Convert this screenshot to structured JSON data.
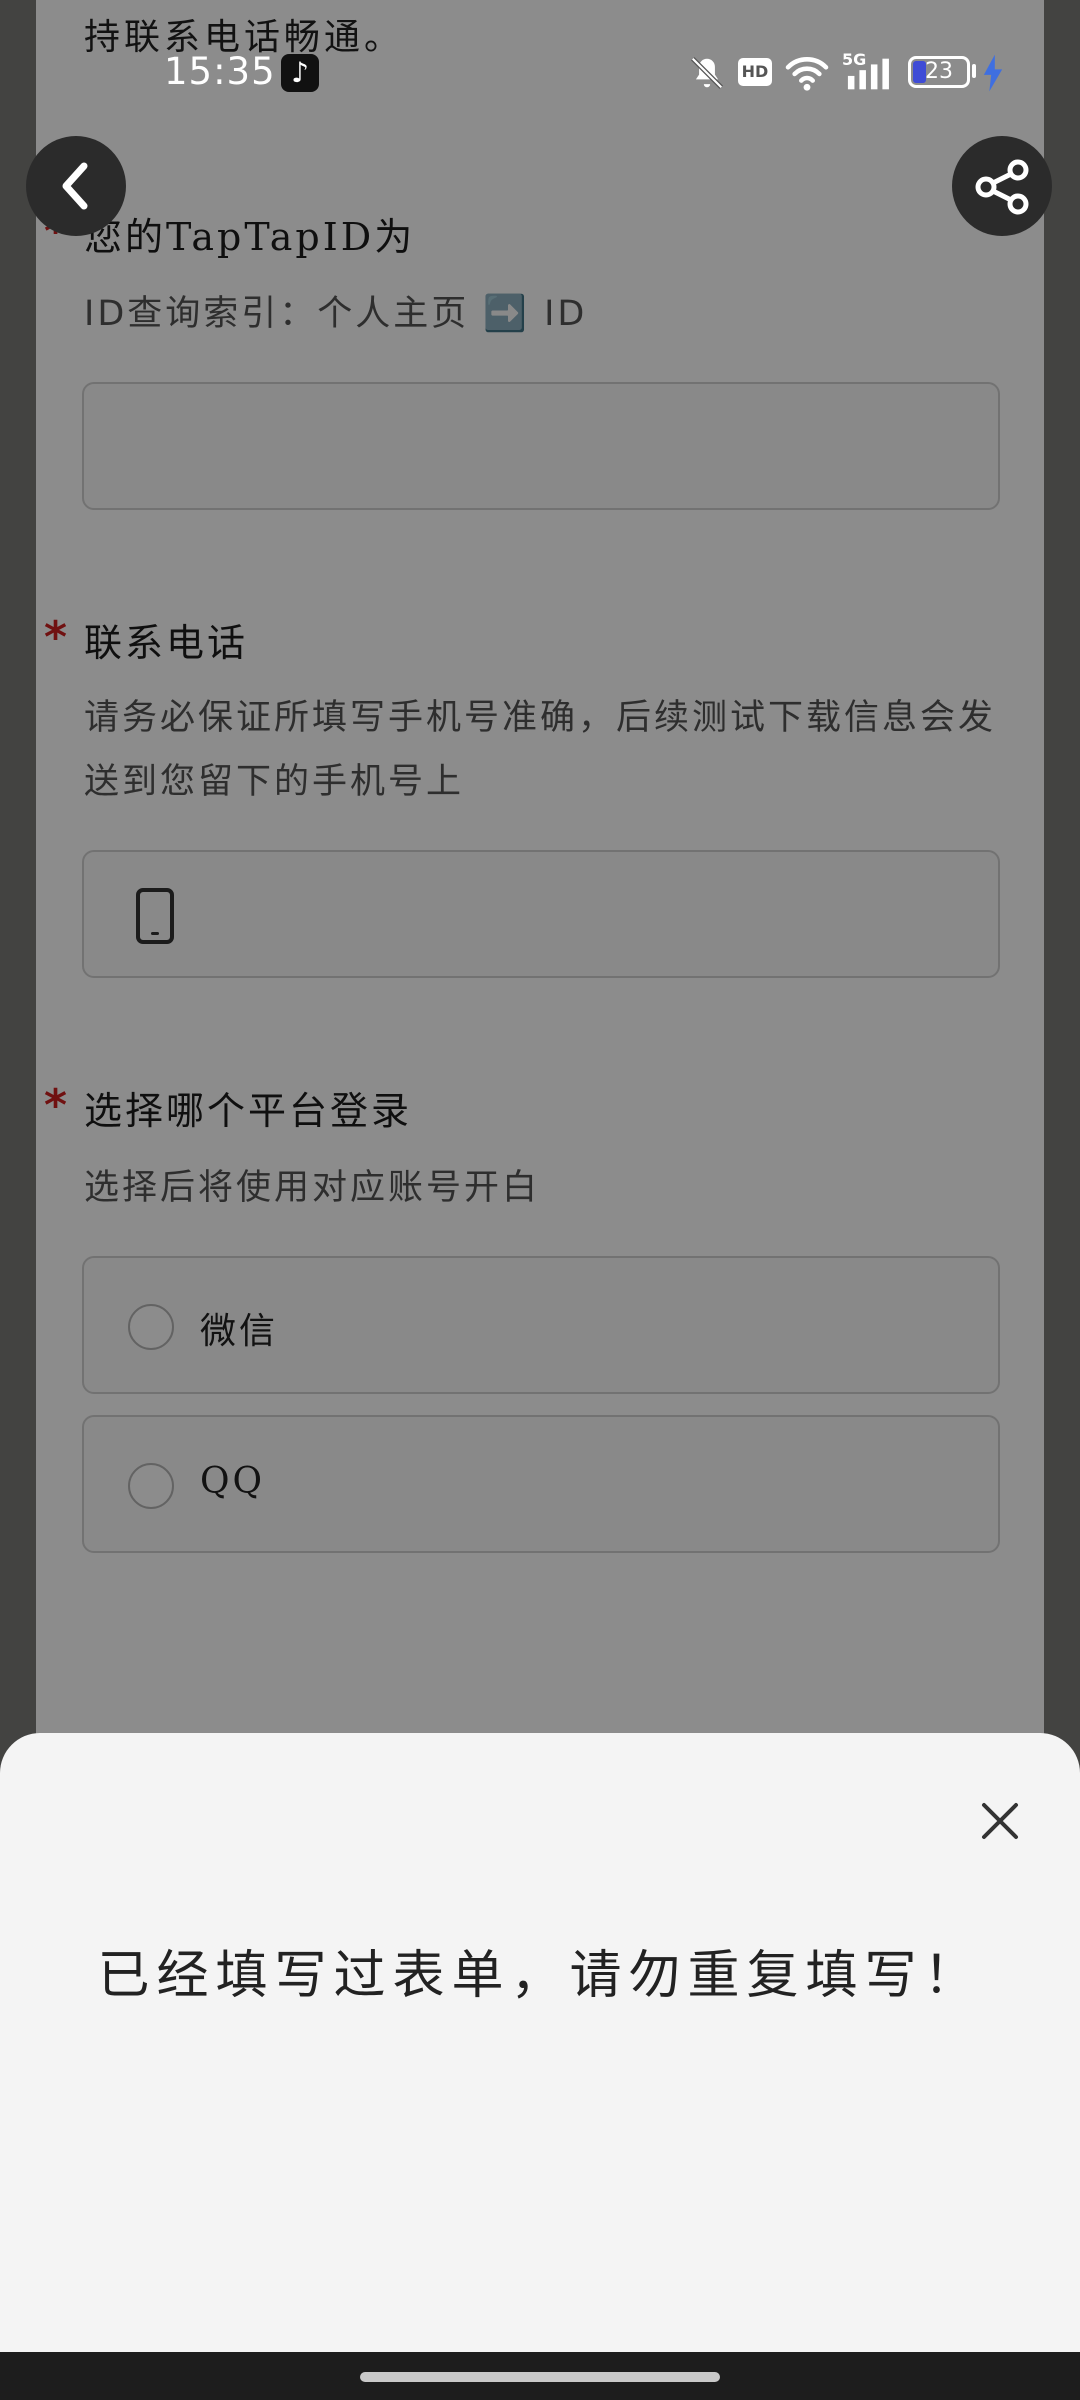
{
  "status_bar": {
    "time": "15:35",
    "network": "5G",
    "hd": "HD",
    "battery_percent": "23",
    "battery_level": 0.23
  },
  "form": {
    "top_cut_text": "持联系电话畅通。",
    "questions": [
      {
        "title": "您的TapTapID为",
        "description": "ID查询索引：个人主页 ➡️ ID",
        "required_mark": "*"
      },
      {
        "title": "联系电话",
        "description": "请务必保证所填写手机号准确，后续测试下载信息会发送到您留下的手机号上",
        "required_mark": "*"
      },
      {
        "title": "选择哪个平台登录",
        "description": "选择后将使用对应账号开白",
        "required_mark": "*",
        "options": [
          "微信",
          "QQ"
        ]
      }
    ]
  },
  "sheet": {
    "message": "已经填写过表单，请勿重复填写！"
  },
  "colors": {
    "required": "#cc1f1f",
    "battery_fill": "#3f4cd6",
    "charging": "#3f6fe0"
  },
  "icons": {
    "back": "chevron-left-icon",
    "share": "share-icon",
    "close": "close-icon",
    "phone": "phone-icon",
    "mute": "bell-off-icon",
    "wifi": "wifi-icon",
    "signal": "signal-icon",
    "charging": "bolt-icon",
    "app": "tiktok-icon"
  }
}
